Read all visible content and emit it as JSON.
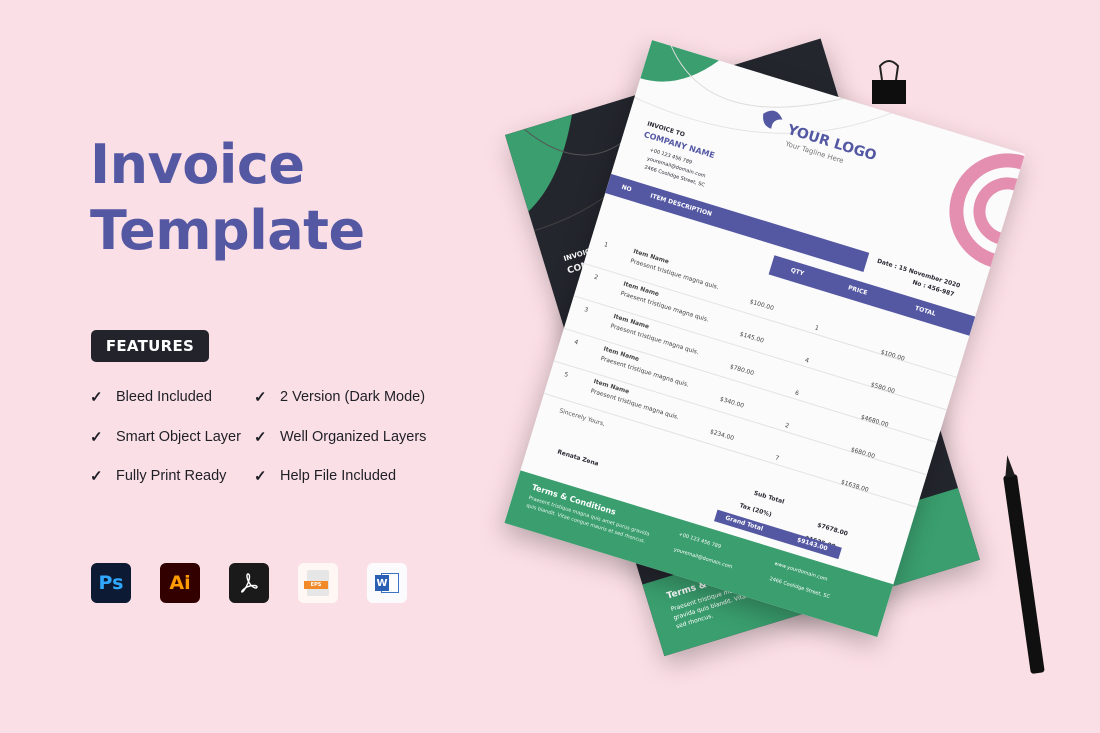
{
  "hero": {
    "title_line1": "Invoice",
    "title_line2": "Template",
    "features_label": "FEATURES",
    "features": [
      "Bleed Included",
      "2 Version (Dark Mode)",
      "Smart Object Layer",
      "Well Organized Layers",
      "Fully Print Ready",
      "Help File Included"
    ],
    "check_glyph": "✓",
    "apps": [
      {
        "icon": "photoshop-icon",
        "label": "Ps"
      },
      {
        "icon": "illustrator-icon",
        "label": "Ai"
      },
      {
        "icon": "acrobat-icon",
        "label": "⅄"
      },
      {
        "icon": "eps-file-icon",
        "label": "EPS"
      },
      {
        "icon": "word-icon",
        "label": "W"
      }
    ]
  },
  "invoice": {
    "logo_text": "YOUR LOGO",
    "tagline": "Your Tagline Here",
    "invoice_to": "INVOICE TO",
    "company": "COMPANY NAME",
    "phone": "+00 123 456 789",
    "email": "youremail@domain.com",
    "address": "2466 Coolidge Street, SC",
    "website": "www.yourdomain.com",
    "date": "Date : 15 November 2020",
    "number": "No : 456-987",
    "headers": {
      "no": "NO",
      "desc": "ITEM DESCRIPTION",
      "qty": "QTY",
      "price": "PRICE",
      "total": "TOTAL"
    },
    "items": [
      {
        "no": "1",
        "name": "Item Name",
        "desc": "Praesent tristique magna quis.",
        "price": "$100.00",
        "qty": "1",
        "total": "$100.00"
      },
      {
        "no": "2",
        "name": "Item Name",
        "desc": "Praesent tristique magna quis.",
        "price": "$145.00",
        "qty": "4",
        "total": "$580.00"
      },
      {
        "no": "3",
        "name": "Item Name",
        "desc": "Praesent tristique magna quis.",
        "price": "$780.00",
        "qty": "6",
        "total": "$4680.00"
      },
      {
        "no": "4",
        "name": "Item Name",
        "desc": "Praesent tristique magna quis.",
        "price": "$340.00",
        "qty": "2",
        "total": "$680.00"
      },
      {
        "no": "5",
        "name": "Item Name",
        "desc": "Praesent tristique magna quis.",
        "price": "$234.00",
        "qty": "7",
        "total": "$1638.00"
      }
    ],
    "closing": "Sincerely Yours,",
    "signer": "Renata Zena",
    "subtotal_label": "Sub Total",
    "subtotal": "$7678.00",
    "tax_label": "Tax (20%)",
    "tax": "$1535.00",
    "grand_label": "Grand Total",
    "grand": "$9143.00",
    "terms_title": "Terms & Conditions",
    "terms_body": "Praesent tristique magna quis amet purus gravida quis blandit. Vitae congue mauris et sed rhoncus."
  },
  "colors": {
    "background": "#fbdfe6",
    "brand_purple": "#5458a3",
    "green": "#3a9e6e",
    "pink": "#e48fb0",
    "dark": "#24262e"
  }
}
